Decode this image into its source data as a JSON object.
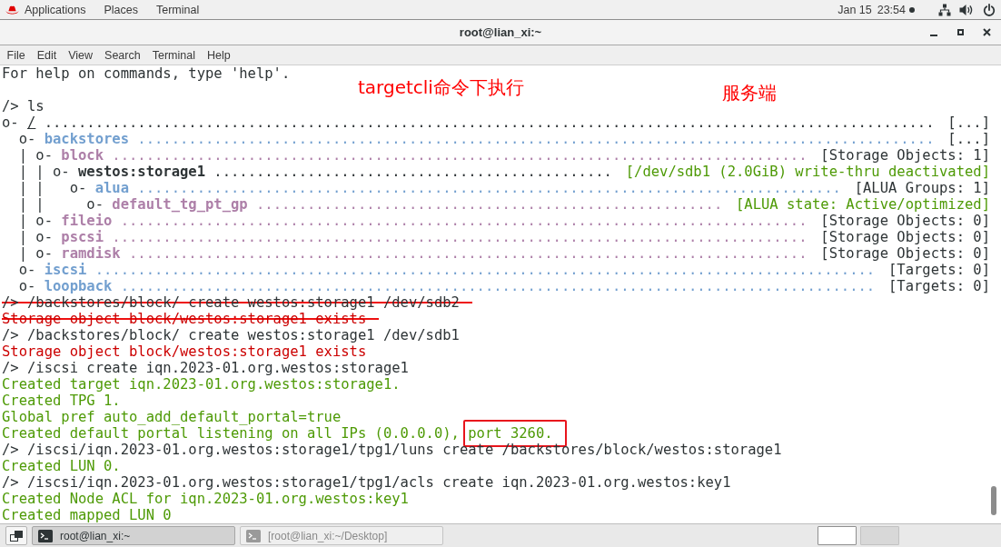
{
  "top_bar": {
    "menus": [
      "Applications",
      "Places",
      "Terminal"
    ],
    "date": "Jan 15",
    "time": "23:54"
  },
  "window": {
    "title": "root@lian_xi:~",
    "menu": [
      "File",
      "Edit",
      "View",
      "Search",
      "Terminal",
      "Help"
    ]
  },
  "terminal": {
    "lines": [
      {
        "kind": "output",
        "text": "For help on commands, type 'help'.",
        "struck": false
      },
      {
        "kind": "blank"
      },
      {
        "kind": "command",
        "text": "/> ls",
        "struck": false
      },
      {
        "kind": "tree",
        "nodes": [
          {
            "prefix": "o- ",
            "name": "/",
            "kind": "root",
            "leader": ".........................................................................................................",
            "summary": "[...]",
            "summary_ok": false,
            "children": [
              {
                "prefix": "  o- ",
                "name": "backstores",
                "kind": "group",
                "leader": "..............................................................................................",
                "summary": "[...]",
                "summary_ok": false,
                "children": [
                  {
                    "prefix": "  | o- ",
                    "name": "block",
                    "kind": "node",
                    "leader": "..................................................................................",
                    "summary": "[Storage Objects: 1]",
                    "summary_ok": false,
                    "children": [
                      {
                        "prefix": "  | | o- ",
                        "name": "westos:storage1",
                        "kind": "object",
                        "leader": "...............................................",
                        "summary": "[/dev/sdb1 (2.0GiB) write-thru deactivated]",
                        "summary_ok": true,
                        "children": [
                          {
                            "prefix": "  | |   o- ",
                            "name": "alua",
                            "kind": "group",
                            "leader": "...................................................................................",
                            "summary": "[ALUA Groups: 1]",
                            "summary_ok": false,
                            "children": [
                              {
                                "prefix": "  | |     o- ",
                                "name": "default_tg_pt_gp",
                                "kind": "node",
                                "leader": ".......................................................",
                                "summary": "[ALUA state: Active/optimized]",
                                "summary_ok": true
                              }
                            ]
                          }
                        ]
                      }
                    ]
                  },
                  {
                    "prefix": "  | o- ",
                    "name": "fileio",
                    "kind": "node",
                    "leader": ".................................................................................",
                    "summary": "[Storage Objects: 0]",
                    "summary_ok": false
                  },
                  {
                    "prefix": "  | o- ",
                    "name": "pscsi",
                    "kind": "node",
                    "leader": "..................................................................................",
                    "summary": "[Storage Objects: 0]",
                    "summary_ok": false
                  },
                  {
                    "prefix": "  | o- ",
                    "name": "ramdisk",
                    "kind": "node",
                    "leader": "................................................................................",
                    "summary": "[Storage Objects: 0]",
                    "summary_ok": false
                  }
                ]
              },
              {
                "prefix": "  o- ",
                "name": "iscsi",
                "kind": "group",
                "leader": "............................................................................................",
                "summary": "[Targets: 0]",
                "summary_ok": false
              },
              {
                "prefix": "  o- ",
                "name": "loopback",
                "kind": "group",
                "leader": ".........................................................................................",
                "summary": "[Targets: 0]",
                "summary_ok": false
              }
            ]
          }
        ]
      },
      {
        "kind": "command",
        "text": "/> /backstores/block/ create westos:storage1 /dev/sdb2",
        "struck": true
      },
      {
        "kind": "error",
        "text": "Storage object block/westos:storage1 exists",
        "struck": true
      },
      {
        "kind": "command",
        "text": "/> /backstores/block/ create westos:storage1 /dev/sdb1",
        "struck": false
      },
      {
        "kind": "error",
        "text": "Storage object block/westos:storage1 exists",
        "struck": false
      },
      {
        "kind": "command",
        "text": "/> /iscsi create iqn.2023-01.org.westos:storage1",
        "struck": false
      },
      {
        "kind": "success",
        "text": "Created target iqn.2023-01.org.westos:storage1.",
        "struck": false
      },
      {
        "kind": "success",
        "text": "Created TPG 1.",
        "struck": false
      },
      {
        "kind": "success",
        "text": "Global pref auto_add_default_portal=true",
        "struck": false
      },
      {
        "kind": "success",
        "text": "Created default portal listening on all IPs (0.0.0.0), ",
        "highlight": "port 3260.",
        "struck": false
      },
      {
        "kind": "command",
        "text": "/> /iscsi/iqn.2023-01.org.westos:storage1/tpg1/luns create /backstores/block/westos:storage1",
        "struck": false
      },
      {
        "kind": "success",
        "text": "Created LUN 0.",
        "struck": false
      },
      {
        "kind": "command",
        "text": "/> /iscsi/iqn.2023-01.org.westos:storage1/tpg1/acls create iqn.2023-01.org.westos:key1",
        "struck": false
      },
      {
        "kind": "success",
        "text": "Created Node ACL for iqn.2023-01.org.westos:key1",
        "struck": false
      },
      {
        "kind": "success",
        "text": "Created mapped LUN 0",
        "struck": false
      }
    ]
  },
  "annotations": [
    "targetcli命令下执行",
    "服务端"
  ],
  "taskbar": {
    "windows": [
      {
        "label": "root@lian_xi:~",
        "selected": true
      },
      {
        "label": "[root@lian_xi:~/Desktop]",
        "selected": false
      }
    ],
    "workspaces": [
      {
        "selected": true
      },
      {
        "selected": false
      }
    ]
  }
}
